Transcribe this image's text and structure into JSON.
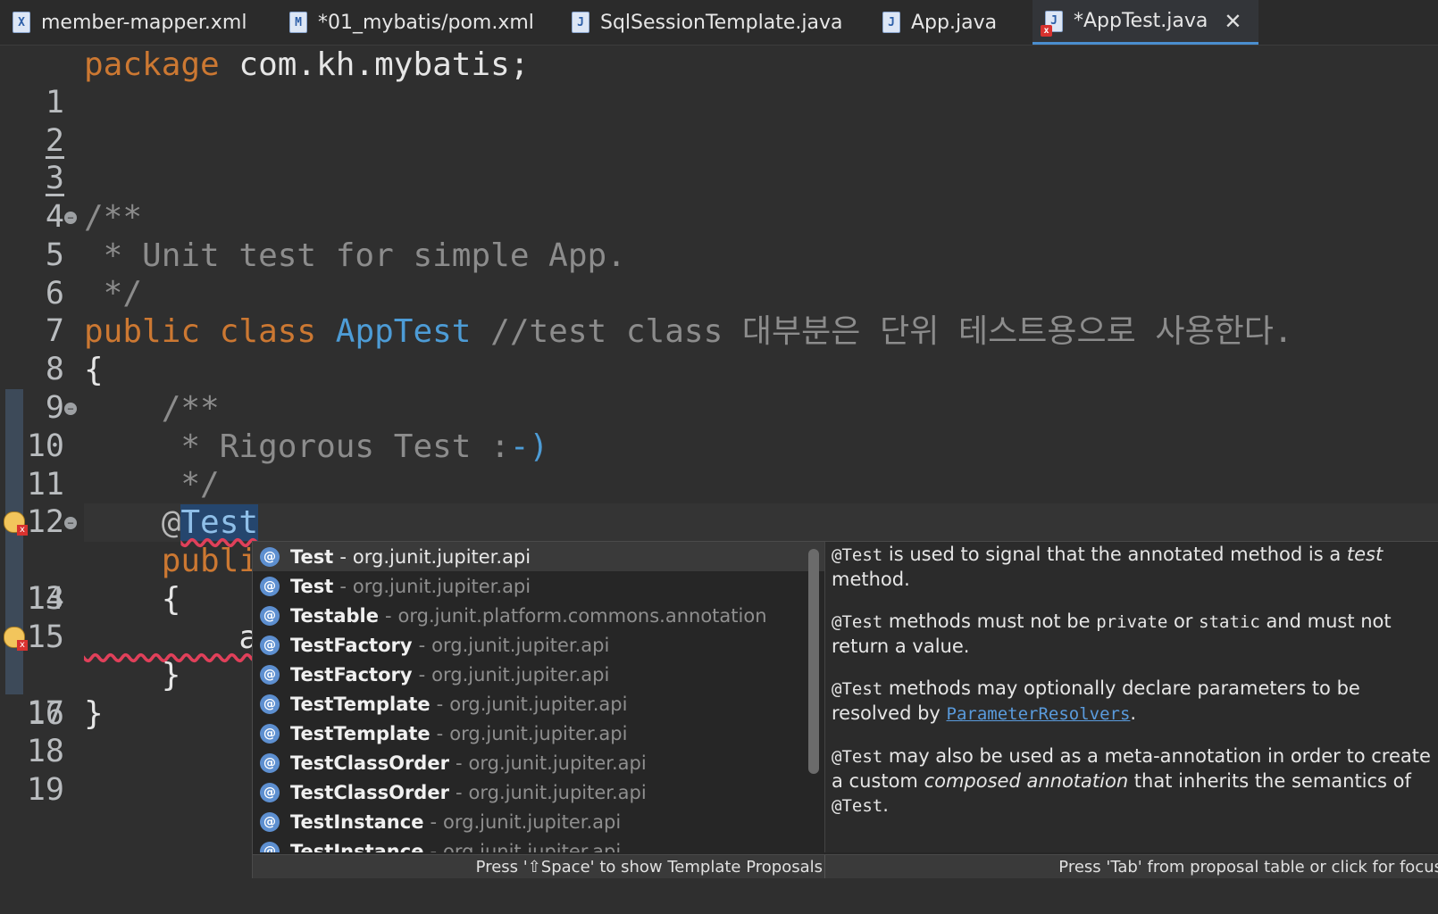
{
  "tabs": [
    {
      "label": "member-mapper.xml",
      "icon": "xml-file-icon",
      "glyph": "X"
    },
    {
      "label": "*01_mybatis/pom.xml",
      "icon": "maven-pom-icon",
      "glyph": "M"
    },
    {
      "label": "SqlSessionTemplate.java",
      "icon": "java-file-icon",
      "glyph": "J"
    },
    {
      "label": "App.java",
      "icon": "java-file-icon",
      "glyph": "J"
    },
    {
      "label": "*AppTest.java",
      "icon": "java-file-error-icon",
      "glyph": "J",
      "active": true
    }
  ],
  "editor": {
    "line_numbers": [
      "1",
      "2",
      "3",
      "4",
      "5",
      "6",
      "7",
      "8",
      "9",
      "10",
      "11",
      "12",
      "13",
      "14",
      "15",
      "16",
      "17",
      "18",
      "19"
    ],
    "code": {
      "l1_kw": "package",
      "l1_rest": " com.kh.mybatis;",
      "l5": "/**",
      "l6": " * Unit test for simple App.",
      "l7": " */",
      "l8_kw": "public class ",
      "l8_cls": "AppTest",
      "l8_cmt": " //test class 대부분은 단위 테스트용으로 사용한다.",
      "l9": "{",
      "l10": "    /**",
      "l11_a": "     * Rigorous Test :",
      "l11_b": "-)",
      "l12": "     */",
      "l13_at": "    @",
      "l13_sel": "Test",
      "l14": "    publi",
      "l15": "    {",
      "l16": "        a",
      "l17": "    }",
      "l18": "}"
    }
  },
  "completion": {
    "proposals": [
      {
        "name": "Test",
        "pkg": "org.junit.jupiter.api",
        "selected": true
      },
      {
        "name": "Test",
        "pkg": "org.junit.jupiter.api"
      },
      {
        "name": "Testable",
        "pkg": "org.junit.platform.commons.annotation"
      },
      {
        "name": "TestFactory",
        "pkg": "org.junit.jupiter.api"
      },
      {
        "name": "TestFactory",
        "pkg": "org.junit.jupiter.api"
      },
      {
        "name": "TestTemplate",
        "pkg": "org.junit.jupiter.api"
      },
      {
        "name": "TestTemplate",
        "pkg": "org.junit.jupiter.api"
      },
      {
        "name": "TestClassOrder",
        "pkg": "org.junit.jupiter.api"
      },
      {
        "name": "TestClassOrder",
        "pkg": "org.junit.jupiter.api"
      },
      {
        "name": "TestInstance",
        "pkg": "org.junit.jupiter.api"
      },
      {
        "name": "TestInstance",
        "pkg": "org.junit.jupiter.api"
      }
    ],
    "separator": "-",
    "doc": {
      "p1_code": "@Test",
      "p1_a": " is used to signal that the annotated method is a ",
      "p1_em": "test",
      "p1_b": " method.",
      "p2_code": "@Test",
      "p2_a": " methods must not be ",
      "p2_code2": "private",
      "p2_b": " or ",
      "p2_code3": "static",
      "p2_c": " and must not return a value.",
      "p3_code": "@Test",
      "p3_a": " methods may optionally declare parameters to be resolved by ",
      "p3_link": "ParameterResolvers",
      "p3_b": ".",
      "p4_code": "@Test",
      "p4_a": " may also be used as a meta-annotation in order to create a custom ",
      "p4_em": "composed annotation",
      "p4_b": " that inherits the semantics of ",
      "p4_code2": "@Test",
      "p4_c": "."
    },
    "status_left": "Press '⇧Space' to show Template Proposals",
    "status_right": "Press 'Tab' from proposal table or click for focus"
  },
  "colors": {
    "background": "#2f2f2f",
    "keyword": "#cc7832",
    "class_name": "#4d9cd6",
    "comment": "#8c8c8c",
    "selection": "#25466e",
    "active_tab_underline": "#4a8ecf"
  }
}
